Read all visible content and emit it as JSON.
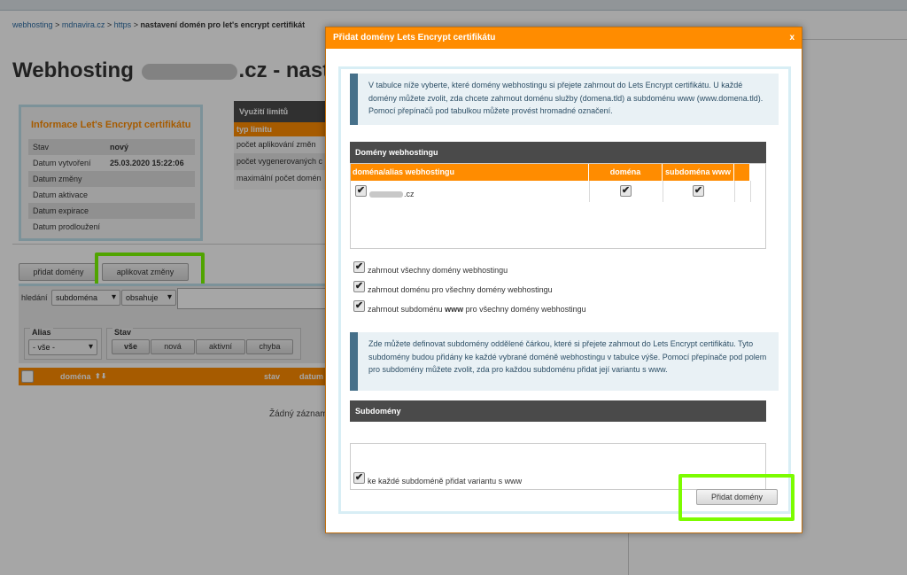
{
  "breadcrumb": {
    "item1": "webhosting",
    "sep": ">",
    "item2": "mdnavira.cz",
    "item3": "https",
    "current": "nastavení domén pro let's encrypt certifikát"
  },
  "page": {
    "title_prefix": "Webhosting",
    "title_suffix": ".cz - nasta"
  },
  "info_box": {
    "title": "Informace Let's Encrypt certifikátu",
    "rows": [
      {
        "label": "Stav",
        "value": "nový"
      },
      {
        "label": "Datum vytvoření",
        "value": "25.03.2020 15:22:06"
      },
      {
        "label": "Datum změny",
        "value": ""
      },
      {
        "label": "Datum aktivace",
        "value": ""
      },
      {
        "label": "Datum expirace",
        "value": ""
      },
      {
        "label": "Datum prodloužení",
        "value": ""
      }
    ]
  },
  "limits": {
    "title": "Využití limitů",
    "col_type": "typ limitu",
    "rows": [
      "počet aplikování změn",
      "počet vygenerovaných c",
      "maximální počet domén"
    ]
  },
  "actions": {
    "add_domains": "přidat domény",
    "apply_changes": "aplikovat změny"
  },
  "search": {
    "label": "hledání",
    "field_select": "subdoména",
    "op_select": "obsahuje"
  },
  "filters": {
    "alias_legend": "Alias",
    "alias_select": "- vše -",
    "stav_legend": "Stav",
    "stav_buttons": [
      "vše",
      "nová",
      "aktivní",
      "chyba"
    ]
  },
  "main_table": {
    "col_domain": "doména",
    "col_stav": "stav",
    "col_datum": "datum",
    "empty": "Žádný záznam"
  },
  "modal": {
    "title": "Přidat domény Lets Encrypt certifikátu",
    "close": "x",
    "info1": "V tabulce níže vyberte, které domény webhostingu si přejete zahrnout do Lets Encrypt certifikátu. U každé domény můžete zvolit, zda chcete zahrnout doménu služby (domena.tld) a subdoménu www (www.domena.tld). Pomocí přepínačů pod tabulkou můžete provést hromadné označení.",
    "domains_panel": "Domény webhostingu",
    "col_alias": "doména/alias webhostingu",
    "col_domena": "doména",
    "col_sub_www": "subdoména www",
    "domain_row": {
      "name_suffix": ".cz",
      "domena_checked": true,
      "www_checked": true
    },
    "check_mark": "✔",
    "opt_all_domains": "zahrnout všechny domény webhostingu",
    "opt_domain_all": "zahrnout doménu pro všechny domény webhostingu",
    "opt_sub_pre": "zahrnout subdoménu",
    "opt_sub_bold": "www",
    "opt_sub_post": "pro všechny domény webhostingu",
    "info2": "Zde můžete definovat subdomény oddělené čárkou, které si přejete zahrnout do Lets Encrypt certifikátu. Tyto subdomény budou přidány ke každé vybrané doméně webhostingu v tabulce výše. Pomocí přepínače pod polem pro subdomény můžete zvolit, zda pro každou subdoménu přidat její variantu s www.",
    "subdomains_panel": "Subdomény",
    "opt_www_variant": "ke každé subdoméně přidat variantu s www",
    "submit": "Přidat domény"
  },
  "colors": {
    "accent_orange": "#ff8c00",
    "highlight_green": "#7cfc00",
    "dark_header": "#4a4a4a",
    "info_border": "#46708a"
  }
}
